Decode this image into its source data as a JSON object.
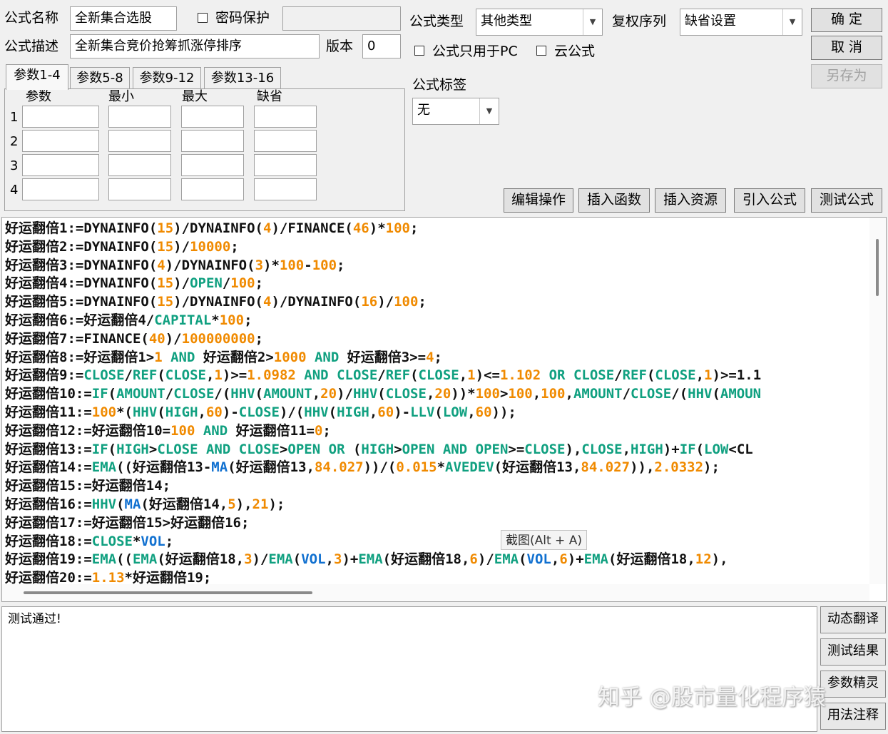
{
  "form": {
    "name_label": "公式名称",
    "name_value": "全新集合选股",
    "password_label": "密码保护",
    "desc_label": "公式描述",
    "desc_value": "全新集合竞价抢筹抓涨停排序",
    "version_label": "版本",
    "version_value": "0",
    "type_label": "公式类型",
    "type_value": "其他类型",
    "rights_label": "复权序列",
    "rights_value": "缺省设置",
    "pc_only_label": "公式只用于PC",
    "cloud_label": "云公式",
    "tag_label": "公式标签",
    "tag_value": "无"
  },
  "buttons": {
    "ok": "确 定",
    "cancel": "取 消",
    "save_as": "另存为",
    "edit_ops": "编辑操作",
    "insert_func": "插入函数",
    "insert_res": "插入资源",
    "import_formula": "引入公式",
    "test_formula": "测试公式"
  },
  "tabs": [
    "参数1-4",
    "参数5-8",
    "参数9-12",
    "参数13-16"
  ],
  "params": {
    "headers": [
      "参数",
      "最小",
      "最大",
      "缺省"
    ],
    "rows": [
      "1",
      "2",
      "3",
      "4"
    ]
  },
  "code_lines": [
    [
      [
        "好运翻倍1:=DYNAINFO(",
        "t"
      ],
      [
        "15",
        "n"
      ],
      [
        ")/DYNAINFO(",
        "t"
      ],
      [
        "4",
        "n"
      ],
      [
        ")/FINANCE(",
        "t"
      ],
      [
        "46",
        "n"
      ],
      [
        ")*",
        "t"
      ],
      [
        "100",
        "n"
      ],
      [
        ";",
        "t"
      ]
    ],
    [
      [
        "好运翻倍2:=DYNAINFO(",
        "t"
      ],
      [
        "15",
        "n"
      ],
      [
        ")/",
        "t"
      ],
      [
        "10000",
        "n"
      ],
      [
        ";",
        "t"
      ]
    ],
    [
      [
        "好运翻倍3:=DYNAINFO(",
        "t"
      ],
      [
        "4",
        "n"
      ],
      [
        ")/DYNAINFO(",
        "t"
      ],
      [
        "3",
        "n"
      ],
      [
        ")*",
        "t"
      ],
      [
        "100",
        "n"
      ],
      [
        "-",
        "t"
      ],
      [
        "100",
        "n"
      ],
      [
        ";",
        "t"
      ]
    ],
    [
      [
        "好运翻倍4:=DYNAINFO(",
        "t"
      ],
      [
        "15",
        "n"
      ],
      [
        ")/",
        "t"
      ],
      [
        "OPEN",
        "k"
      ],
      [
        "/",
        "t"
      ],
      [
        "100",
        "n"
      ],
      [
        ";",
        "t"
      ]
    ],
    [
      [
        "好运翻倍5:=DYNAINFO(",
        "t"
      ],
      [
        "15",
        "n"
      ],
      [
        ")/DYNAINFO(",
        "t"
      ],
      [
        "4",
        "n"
      ],
      [
        ")/DYNAINFO(",
        "t"
      ],
      [
        "16",
        "n"
      ],
      [
        ")/",
        "t"
      ],
      [
        "100",
        "n"
      ],
      [
        ";",
        "t"
      ]
    ],
    [
      [
        "好运翻倍6:=好运翻倍4/",
        "t"
      ],
      [
        "CAPITAL",
        "k"
      ],
      [
        "*",
        "t"
      ],
      [
        "100",
        "n"
      ],
      [
        ";",
        "t"
      ]
    ],
    [
      [
        "好运翻倍7:=FINANCE(",
        "t"
      ],
      [
        "40",
        "n"
      ],
      [
        ")/",
        "t"
      ],
      [
        "100000000",
        "n"
      ],
      [
        ";",
        "t"
      ]
    ],
    [
      [
        "好运翻倍8:=好运翻倍1>",
        "t"
      ],
      [
        "1",
        "n"
      ],
      [
        " ",
        "t"
      ],
      [
        "AND",
        "k"
      ],
      [
        " 好运翻倍2>",
        "t"
      ],
      [
        "1000",
        "n"
      ],
      [
        " ",
        "t"
      ],
      [
        "AND",
        "k"
      ],
      [
        " 好运翻倍3>=",
        "t"
      ],
      [
        "4",
        "n"
      ],
      [
        ";",
        "t"
      ]
    ],
    [
      [
        "好运翻倍9:=",
        "t"
      ],
      [
        "CLOSE",
        "k"
      ],
      [
        "/",
        "t"
      ],
      [
        "REF",
        "k"
      ],
      [
        "(",
        "t"
      ],
      [
        "CLOSE",
        "k"
      ],
      [
        ",",
        "t"
      ],
      [
        "1",
        "n"
      ],
      [
        ")>=",
        "t"
      ],
      [
        "1.0982",
        "n"
      ],
      [
        " ",
        "t"
      ],
      [
        "AND",
        "k"
      ],
      [
        " ",
        "t"
      ],
      [
        "CLOSE",
        "k"
      ],
      [
        "/",
        "t"
      ],
      [
        "REF",
        "k"
      ],
      [
        "(",
        "t"
      ],
      [
        "CLOSE",
        "k"
      ],
      [
        ",",
        "t"
      ],
      [
        "1",
        "n"
      ],
      [
        ")<=",
        "t"
      ],
      [
        "1.102",
        "n"
      ],
      [
        " ",
        "t"
      ],
      [
        "OR",
        "k"
      ],
      [
        " ",
        "t"
      ],
      [
        "CLOSE",
        "k"
      ],
      [
        "/",
        "t"
      ],
      [
        "REF",
        "k"
      ],
      [
        "(",
        "t"
      ],
      [
        "CLOSE",
        "k"
      ],
      [
        ",",
        "t"
      ],
      [
        "1",
        "n"
      ],
      [
        ")>=1.1",
        "t"
      ]
    ],
    [
      [
        "好运翻倍10:=",
        "t"
      ],
      [
        "IF",
        "k"
      ],
      [
        "(",
        "t"
      ],
      [
        "AMOUNT",
        "k"
      ],
      [
        "/",
        "t"
      ],
      [
        "CLOSE",
        "k"
      ],
      [
        "/(",
        "t"
      ],
      [
        "HHV",
        "k"
      ],
      [
        "(",
        "t"
      ],
      [
        "AMOUNT",
        "k"
      ],
      [
        ",",
        "t"
      ],
      [
        "20",
        "n"
      ],
      [
        ")/",
        "t"
      ],
      [
        "HHV",
        "k"
      ],
      [
        "(",
        "t"
      ],
      [
        "CLOSE",
        "k"
      ],
      [
        ",",
        "t"
      ],
      [
        "20",
        "n"
      ],
      [
        "))*",
        "t"
      ],
      [
        "100",
        "n"
      ],
      [
        ">",
        "t"
      ],
      [
        "100",
        "n"
      ],
      [
        ",",
        "t"
      ],
      [
        "100",
        "n"
      ],
      [
        ",",
        "t"
      ],
      [
        "AMOUNT",
        "k"
      ],
      [
        "/",
        "t"
      ],
      [
        "CLOSE",
        "k"
      ],
      [
        "/(",
        "t"
      ],
      [
        "HHV",
        "k"
      ],
      [
        "(",
        "t"
      ],
      [
        "AMOUN",
        "k"
      ]
    ],
    [
      [
        "好运翻倍11:=",
        "t"
      ],
      [
        "100",
        "n"
      ],
      [
        "*(",
        "t"
      ],
      [
        "HHV",
        "k"
      ],
      [
        "(",
        "t"
      ],
      [
        "HIGH",
        "k"
      ],
      [
        ",",
        "t"
      ],
      [
        "60",
        "n"
      ],
      [
        ")-",
        "t"
      ],
      [
        "CLOSE",
        "k"
      ],
      [
        ")/(",
        "t"
      ],
      [
        "HHV",
        "k"
      ],
      [
        "(",
        "t"
      ],
      [
        "HIGH",
        "k"
      ],
      [
        ",",
        "t"
      ],
      [
        "60",
        "n"
      ],
      [
        ")-",
        "t"
      ],
      [
        "LLV",
        "k"
      ],
      [
        "(",
        "t"
      ],
      [
        "LOW",
        "k"
      ],
      [
        ",",
        "t"
      ],
      [
        "60",
        "n"
      ],
      [
        "));",
        "t"
      ]
    ],
    [
      [
        "好运翻倍12:=好运翻倍10=",
        "t"
      ],
      [
        "100",
        "n"
      ],
      [
        " ",
        "t"
      ],
      [
        "AND",
        "k"
      ],
      [
        " 好运翻倍11=",
        "t"
      ],
      [
        "0",
        "n"
      ],
      [
        ";",
        "t"
      ]
    ],
    [
      [
        "好运翻倍13:=",
        "t"
      ],
      [
        "IF",
        "k"
      ],
      [
        "(",
        "t"
      ],
      [
        "HIGH",
        "k"
      ],
      [
        ">",
        "t"
      ],
      [
        "CLOSE",
        "k"
      ],
      [
        " ",
        "t"
      ],
      [
        "AND",
        "k"
      ],
      [
        " ",
        "t"
      ],
      [
        "CLOSE",
        "k"
      ],
      [
        ">",
        "t"
      ],
      [
        "OPEN",
        "k"
      ],
      [
        " ",
        "t"
      ],
      [
        "OR",
        "k"
      ],
      [
        " (",
        "t"
      ],
      [
        "HIGH",
        "k"
      ],
      [
        ">",
        "t"
      ],
      [
        "OPEN",
        "k"
      ],
      [
        " ",
        "t"
      ],
      [
        "AND",
        "k"
      ],
      [
        " ",
        "t"
      ],
      [
        "OPEN",
        "k"
      ],
      [
        ">=",
        "t"
      ],
      [
        "CLOSE",
        "k"
      ],
      [
        "),",
        "t"
      ],
      [
        "CLOSE",
        "k"
      ],
      [
        ",",
        "t"
      ],
      [
        "HIGH",
        "k"
      ],
      [
        ")+",
        "t"
      ],
      [
        "IF",
        "k"
      ],
      [
        "(",
        "t"
      ],
      [
        "LOW",
        "k"
      ],
      [
        "<CL",
        "t"
      ]
    ],
    [
      [
        "好运翻倍14:=",
        "t"
      ],
      [
        "EMA",
        "k"
      ],
      [
        "((好运翻倍13-",
        "t"
      ],
      [
        "MA",
        "b"
      ],
      [
        "(好运翻倍13,",
        "t"
      ],
      [
        "84.027",
        "n"
      ],
      [
        "))/(",
        "t"
      ],
      [
        "0.015",
        "n"
      ],
      [
        "*",
        "t"
      ],
      [
        "AVEDEV",
        "k"
      ],
      [
        "(好运翻倍13,",
        "t"
      ],
      [
        "84.027",
        "n"
      ],
      [
        ")),",
        "t"
      ],
      [
        "2.0332",
        "n"
      ],
      [
        ");",
        "t"
      ]
    ],
    [
      [
        "好运翻倍15:=好运翻倍14;",
        "t"
      ]
    ],
    [
      [
        "好运翻倍16:=",
        "t"
      ],
      [
        "HHV",
        "k"
      ],
      [
        "(",
        "t"
      ],
      [
        "MA",
        "b"
      ],
      [
        "(好运翻倍14,",
        "t"
      ],
      [
        "5",
        "n"
      ],
      [
        "),",
        "t"
      ],
      [
        "21",
        "n"
      ],
      [
        ");",
        "t"
      ]
    ],
    [
      [
        "好运翻倍17:=好运翻倍15>好运翻倍16;",
        "t"
      ]
    ],
    [
      [
        "好运翻倍18:=",
        "t"
      ],
      [
        "CLOSE",
        "k"
      ],
      [
        "*",
        "t"
      ],
      [
        "VOL",
        "b"
      ],
      [
        ";",
        "t"
      ]
    ],
    [
      [
        "好运翻倍19:=",
        "t"
      ],
      [
        "EMA",
        "k"
      ],
      [
        "((",
        "t"
      ],
      [
        "EMA",
        "k"
      ],
      [
        "(好运翻倍18,",
        "t"
      ],
      [
        "3",
        "n"
      ],
      [
        ")/",
        "t"
      ],
      [
        "EMA",
        "k"
      ],
      [
        "(",
        "t"
      ],
      [
        "VOL",
        "b"
      ],
      [
        ",",
        "t"
      ],
      [
        "3",
        "n"
      ],
      [
        ")+",
        "t"
      ],
      [
        "EMA",
        "k"
      ],
      [
        "(好运翻倍18,",
        "t"
      ],
      [
        "6",
        "n"
      ],
      [
        ")/",
        "t"
      ],
      [
        "EMA",
        "k"
      ],
      [
        "(",
        "t"
      ],
      [
        "VOL",
        "b"
      ],
      [
        ",",
        "t"
      ],
      [
        "6",
        "n"
      ],
      [
        ")+",
        "t"
      ],
      [
        "EMA",
        "k"
      ],
      [
        "(好运翻倍18,",
        "t"
      ],
      [
        "12",
        "n"
      ],
      [
        "),",
        "t"
      ]
    ],
    [
      [
        "好运翻倍20:=",
        "t"
      ],
      [
        "1.13",
        "n"
      ],
      [
        "*好运翻倍19;",
        "t"
      ]
    ]
  ],
  "tooltip": "截图(Alt + A)",
  "result_text": "测试通过!",
  "side_buttons": [
    "动态翻译",
    "测试结果",
    "参数精灵",
    "用法注释"
  ],
  "watermark": "知乎 @股市量化程序猿",
  "colors": {
    "number": "#f08a00",
    "keyword": "#10a080",
    "blue_fn": "#1070d0"
  }
}
